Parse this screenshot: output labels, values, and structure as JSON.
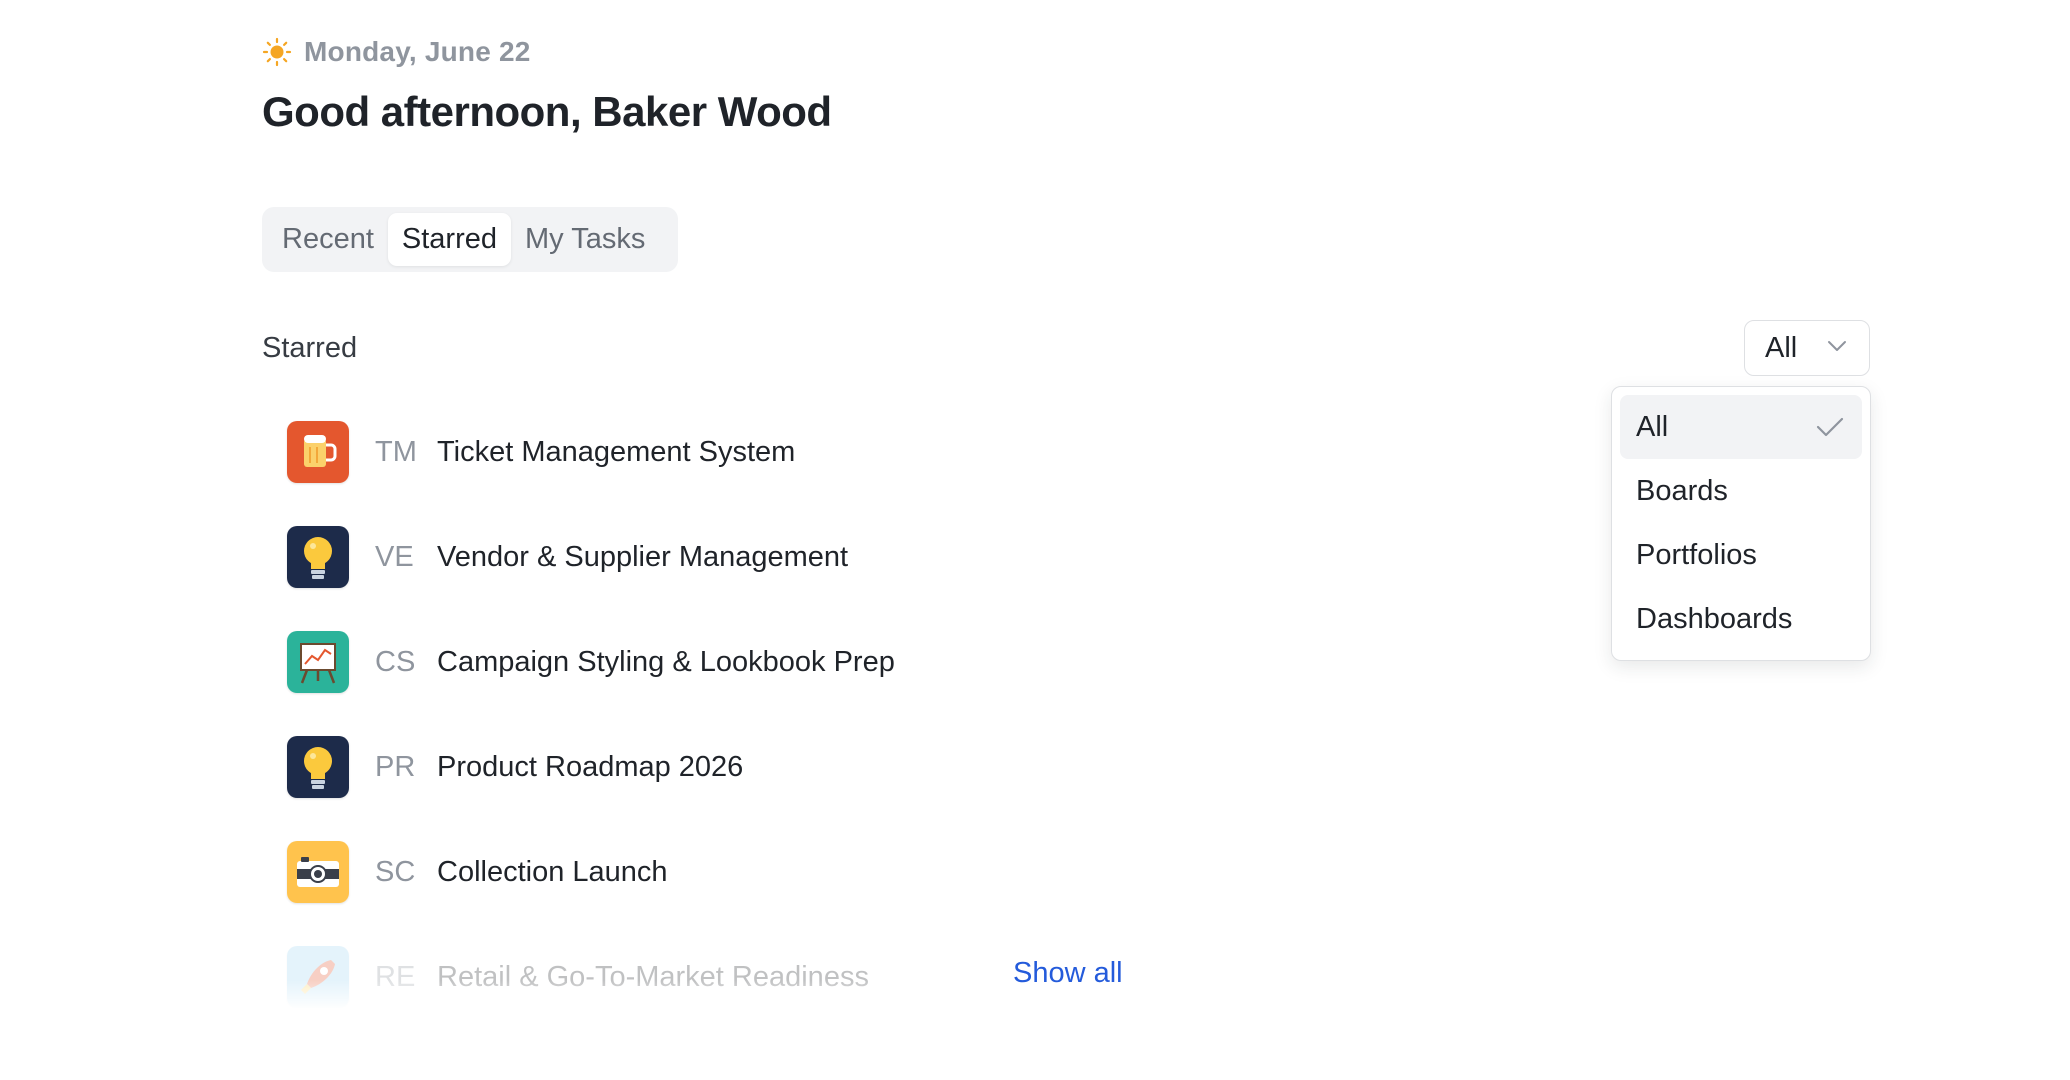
{
  "header": {
    "date": "Monday, June 22",
    "greeting": "Good afternoon, Baker Wood",
    "date_icon": "sun-icon"
  },
  "tabs": [
    {
      "label": "Recent",
      "active": false
    },
    {
      "label": "Starred",
      "active": true
    },
    {
      "label": "My Tasks",
      "active": false
    }
  ],
  "section": {
    "title": "Starred"
  },
  "filter": {
    "selected": "All",
    "options": [
      {
        "label": "All",
        "selected": true
      },
      {
        "label": "Boards",
        "selected": false
      },
      {
        "label": "Portfolios",
        "selected": false
      },
      {
        "label": "Dashboards",
        "selected": false
      }
    ]
  },
  "items": [
    {
      "abbr": "TM",
      "name": "Ticket Management System",
      "icon": "beer-mug-icon",
      "icon_bg": "#e4572e"
    },
    {
      "abbr": "VE",
      "name": "Vendor & Supplier Management",
      "icon": "lightbulb-icon",
      "icon_bg": "#1d2b4a"
    },
    {
      "abbr": "CS",
      "name": "Campaign Styling & Lookbook Prep",
      "icon": "easel-chart-icon",
      "icon_bg": "#2bb39a"
    },
    {
      "abbr": "PR",
      "name": "Product Roadmap 2026",
      "icon": "lightbulb-icon",
      "icon_bg": "#1d2b4a"
    },
    {
      "abbr": "SC",
      "name": "Collection Launch",
      "icon": "camera-icon",
      "icon_bg": "#ffc34d"
    },
    {
      "abbr": "RE",
      "name": "Retail & Go-To-Market Readiness",
      "icon": "rocket-icon",
      "icon_bg": "#9fd6f2"
    }
  ],
  "show_all": "Show all",
  "colors": {
    "accent_link": "#245bdb",
    "muted_text": "#8f959e",
    "tab_bg": "#f2f3f5"
  }
}
